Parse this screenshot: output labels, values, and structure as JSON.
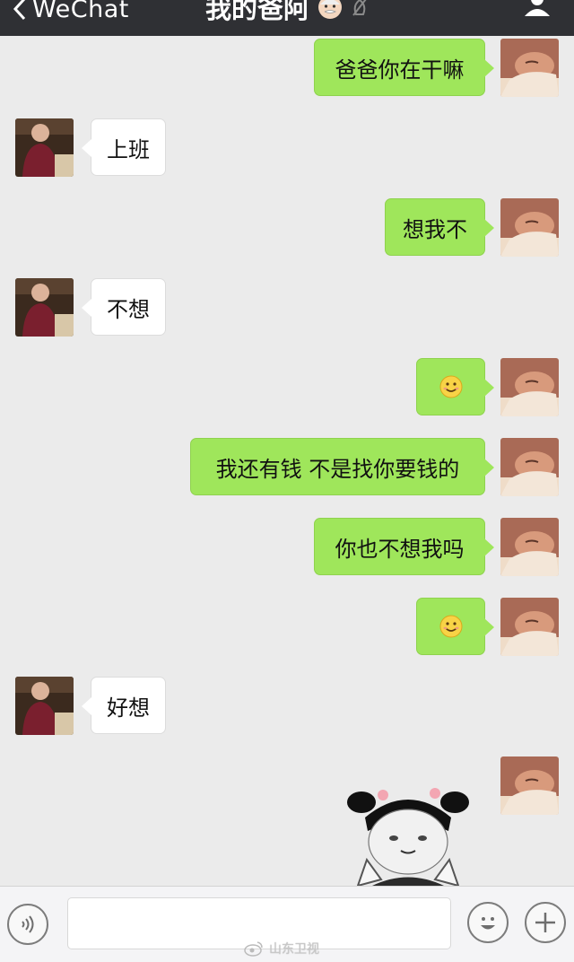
{
  "header": {
    "back_label": "WeChat",
    "title": "我的爸阿"
  },
  "messages": [
    {
      "side": "right",
      "text": "爸爸你在干嘛"
    },
    {
      "side": "left",
      "text": "上班"
    },
    {
      "side": "right",
      "text": "想我不"
    },
    {
      "side": "left",
      "text": "不想"
    },
    {
      "side": "right",
      "emoji": "smile-emoji"
    },
    {
      "side": "right",
      "text": "我还有钱 不是找你要钱的"
    },
    {
      "side": "right",
      "text": "你也不想我吗"
    },
    {
      "side": "right",
      "emoji": "smile-emoji"
    },
    {
      "side": "left",
      "text": "好想"
    },
    {
      "side": "right",
      "sticker": "panda-girl-sticker"
    }
  ],
  "composer": {
    "voice_icon": "voice-icon",
    "emoji_icon": "emoji-icon",
    "more_icon": "plus-icon"
  },
  "watermark": {
    "text": "山东卫视"
  },
  "colors": {
    "navbar": "#2f3034",
    "chat_bg": "#ebebeb",
    "sent_bubble": "#9fe65b",
    "received_bubble": "#ffffff"
  }
}
